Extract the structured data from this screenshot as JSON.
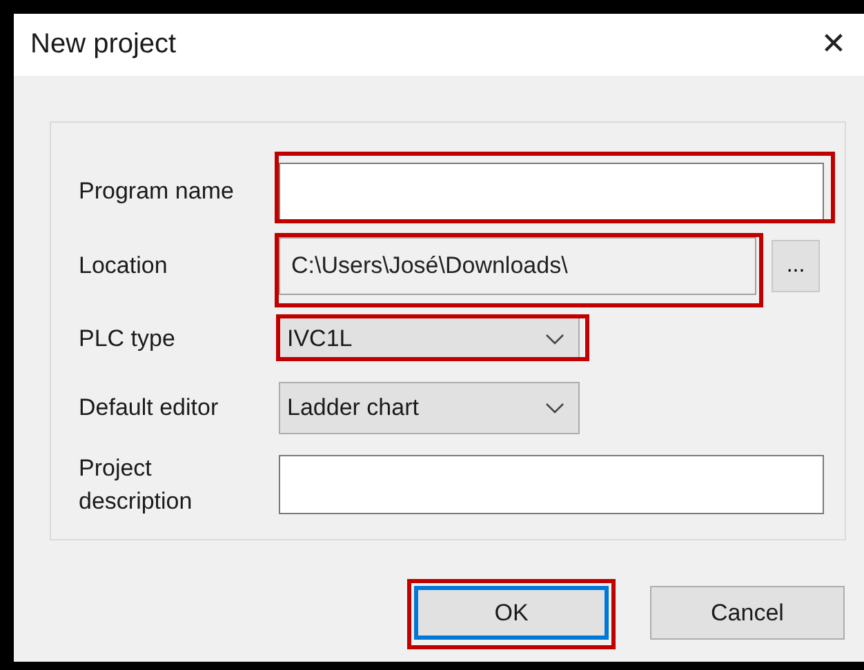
{
  "window": {
    "title": "New project",
    "close_label": "✕"
  },
  "fields": [
    {
      "label": "Program name",
      "kind": "text",
      "highlighted": true
    },
    {
      "label": "Location",
      "kind": "path",
      "value": "C:\\Users\\José\\Downloads\\",
      "browse_button": "...",
      "highlighted": true
    },
    {
      "label": "PLC type",
      "kind": "combo",
      "value": "IVC1L",
      "highlighted": true
    },
    {
      "label": "Default editor",
      "kind": "combo",
      "value": "Ladder chart",
      "highlighted": false
    },
    {
      "label": "Project description",
      "kind": "text",
      "highlighted": false
    }
  ],
  "buttons": [
    {
      "label": "OK",
      "default": true,
      "highlighted": true
    },
    {
      "label": "Cancel",
      "default": false,
      "highlighted": false
    }
  ]
}
